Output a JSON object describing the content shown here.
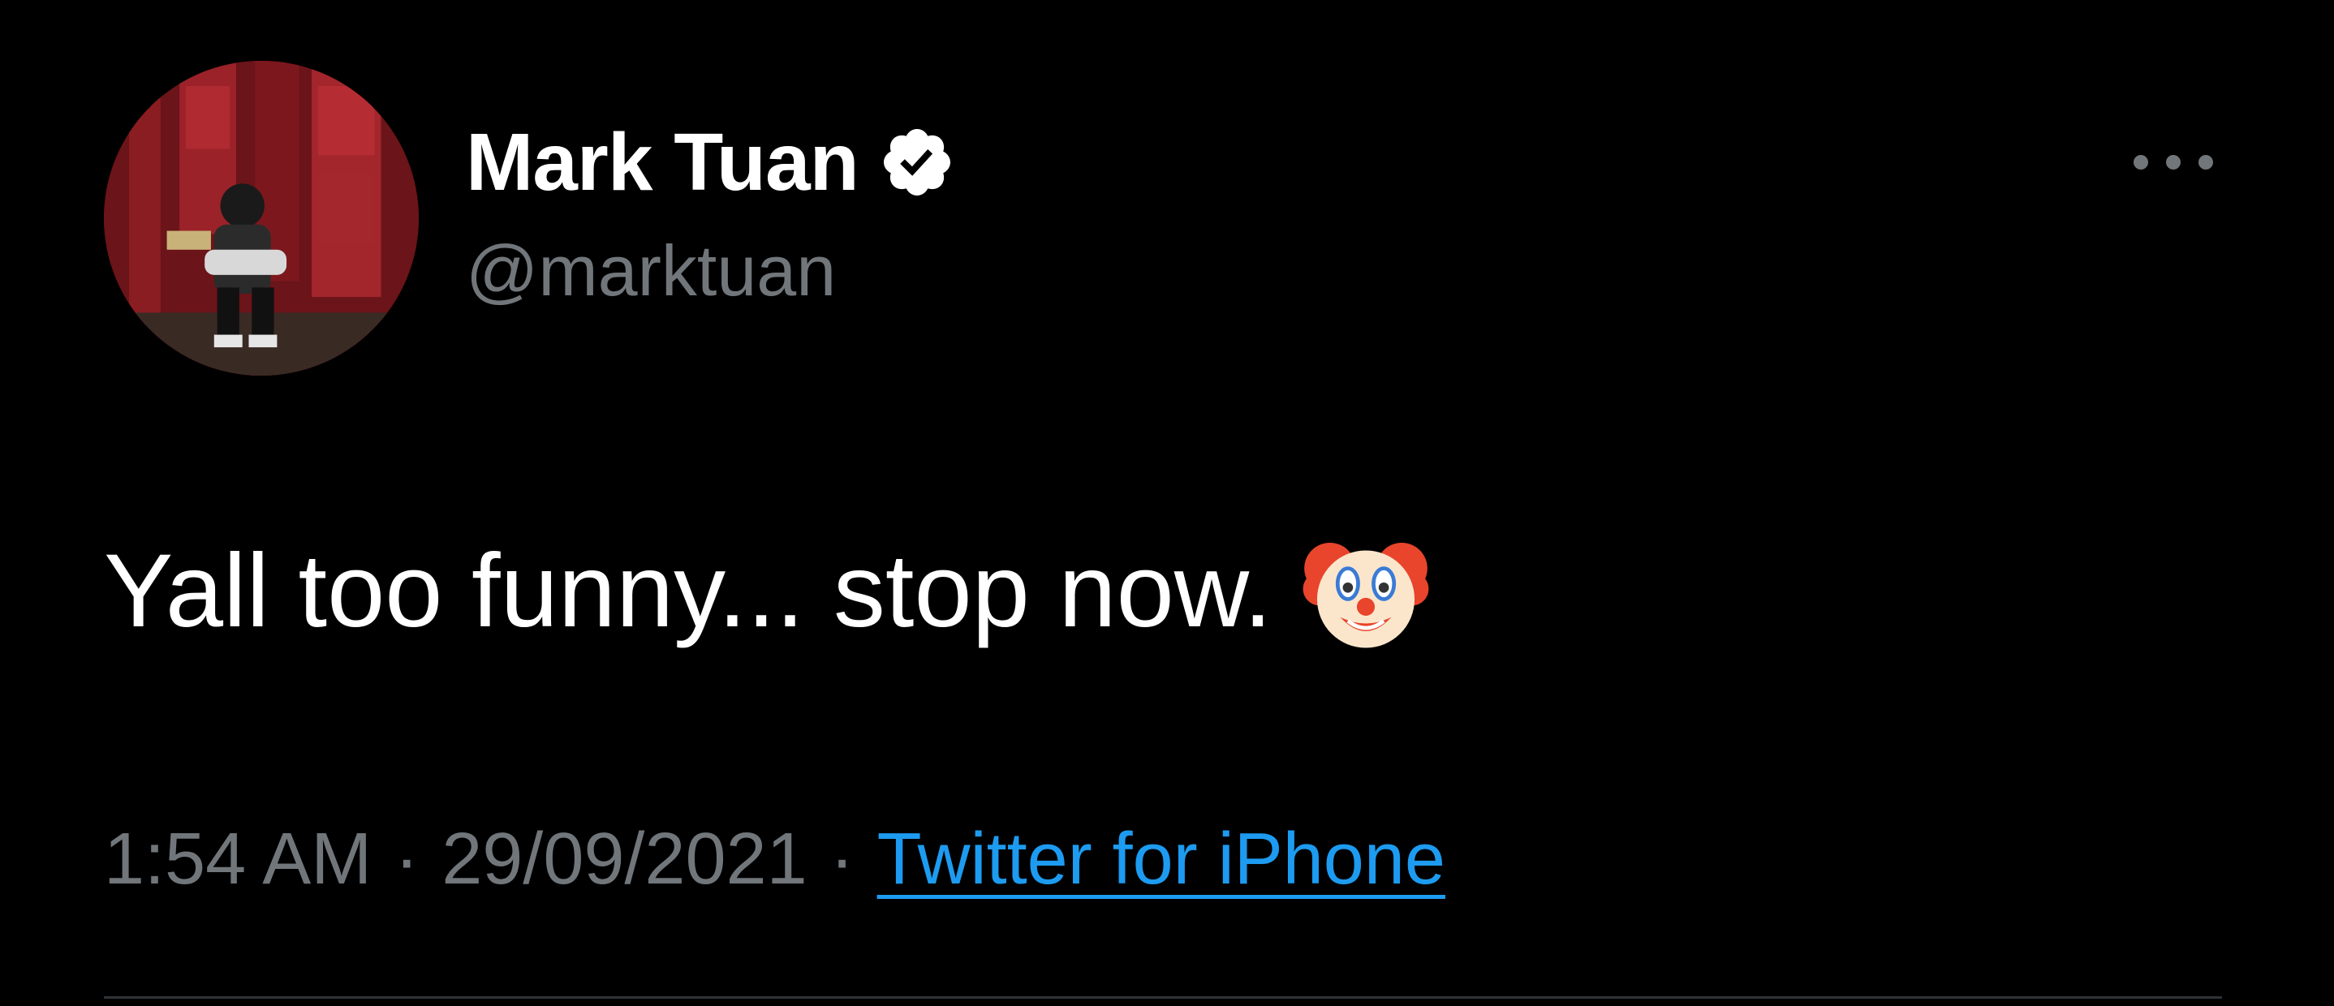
{
  "author": {
    "display_name": "Mark Tuan",
    "handle": "@marktuan",
    "verified": true,
    "avatar_icon": "avatar-photo"
  },
  "tweet": {
    "text": "Yall too funny... stop now.",
    "emoji": "clown-face-icon"
  },
  "meta": {
    "time": "1:54 AM",
    "separator": "·",
    "date": "29/09/2021",
    "source": "Twitter for iPhone"
  },
  "actions": {
    "more_icon": "more-options-icon"
  },
  "colors": {
    "background": "#000000",
    "primary_text": "#ffffff",
    "secondary_text": "#71767b",
    "link": "#1d9bf0",
    "divider": "#2f3336"
  }
}
